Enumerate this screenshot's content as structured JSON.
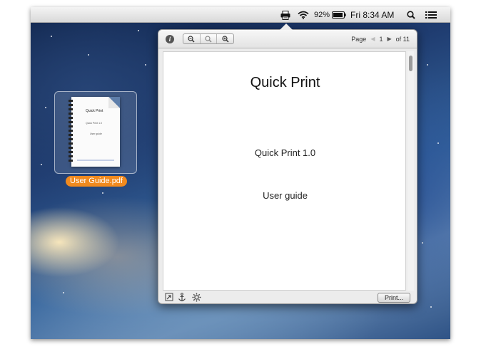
{
  "menubar": {
    "battery_percent": "92%",
    "clock": "Fri 8:34 AM",
    "icons": [
      "printer-icon",
      "wifi-icon",
      "battery-icon",
      "spotlight-icon",
      "notification-list-icon"
    ]
  },
  "desktop": {
    "file": {
      "name": "User Guide.pdf",
      "thumb_title": "Quick Print",
      "thumb_version": "Quick Print 1.0",
      "thumb_subtitle": "User guide"
    }
  },
  "popover": {
    "toolbar": {
      "info_icon": "info-icon",
      "zoom_buttons": [
        "zoom-out-icon",
        "zoom-reset-icon",
        "zoom-in-icon"
      ],
      "page_label": "Page",
      "page_current": "1",
      "page_total": "of 11"
    },
    "document": {
      "title": "Quick Print",
      "version": "Quick Print 1.0",
      "subtitle": "User guide"
    },
    "bottom": {
      "icons": [
        "expand-icon",
        "anchor-icon",
        "gear-icon"
      ],
      "print_label": "Print..."
    }
  },
  "colors": {
    "file_label_bg": "#f18a1e",
    "menubar_bg": "#e6e6e6",
    "popover_bg": "#ececec"
  }
}
